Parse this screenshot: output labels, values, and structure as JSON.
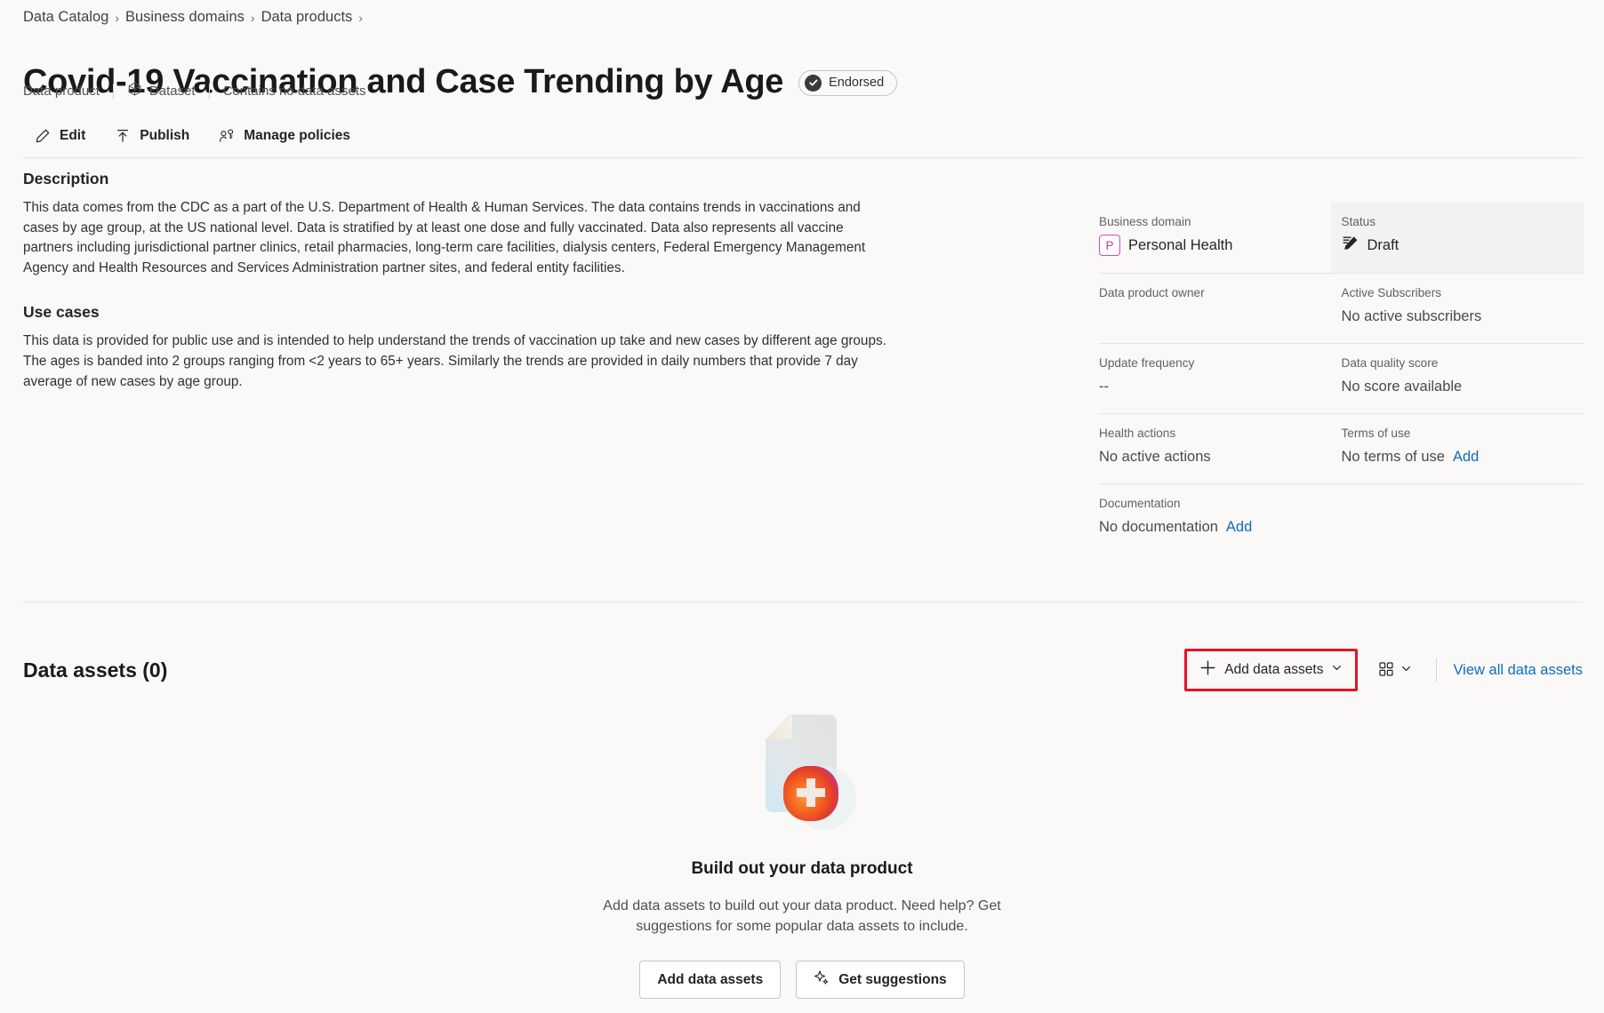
{
  "breadcrumb": {
    "items": [
      {
        "label": "Data Catalog"
      },
      {
        "label": "Business domains"
      },
      {
        "label": "Data products"
      }
    ],
    "separator": "›"
  },
  "header": {
    "title": "Covid-19 Vaccination and Case Trending by Age",
    "endorsed_badge": "Endorsed",
    "subtitle": {
      "type": "Data product",
      "kind": "Dataset",
      "assets_summary": "Contains no data assets"
    }
  },
  "toolbar": {
    "edit_label": "Edit",
    "publish_label": "Publish",
    "manage_policies_label": "Manage policies"
  },
  "description": {
    "heading": "Description",
    "body": "This data comes from the CDC as a part of the U.S. Department of Health & Human Services.  The data contains trends in vaccinations and cases by age group, at the US national level. Data is stratified by at least one dose and fully vaccinated. Data also represents all vaccine partners including jurisdictional partner clinics, retail pharmacies, long-term care facilities, dialysis centers, Federal Emergency Management Agency and Health Resources and Services Administration partner sites, and federal entity facilities."
  },
  "use_cases": {
    "heading": "Use cases",
    "body": "This data is provided for public use and is intended to help understand the trends of vaccination up take and new cases by different age groups.  The ages is banded into 2 groups ranging from <2 years to 65+ years.  Similarly the trends are provided in daily numbers that provide 7 day average of new cases by age group."
  },
  "metadata": {
    "business_domain": {
      "label": "Business domain",
      "badge": "P",
      "value": "Personal Health",
      "badge_color": "#c239b3"
    },
    "status": {
      "label": "Status",
      "value": "Draft",
      "highlighted": true
    },
    "owner": {
      "label": "Data product owner",
      "value": ""
    },
    "subscribers": {
      "label": "Active Subscribers",
      "value": "No active subscribers"
    },
    "update_frequency": {
      "label": "Update frequency",
      "value": "--"
    },
    "quality_score": {
      "label": "Data quality score",
      "value": "No score available"
    },
    "health_actions": {
      "label": "Health actions",
      "value": "No active actions"
    },
    "terms_of_use": {
      "label": "Terms of use",
      "value": "No terms of use",
      "action": "Add"
    },
    "documentation": {
      "label": "Documentation",
      "value": "No documentation",
      "action": "Add"
    }
  },
  "data_assets": {
    "section_title": "Data assets (0)",
    "add_button": "Add data assets",
    "view_all": "View all data assets",
    "highlight_color": "#e81123"
  },
  "empty_state": {
    "title": "Build out your data product",
    "description": "Add data assets to build out your data product. Need help? Get suggestions for some popular data assets to include.",
    "primary_button": "Add data assets",
    "secondary_button": "Get suggestions"
  }
}
